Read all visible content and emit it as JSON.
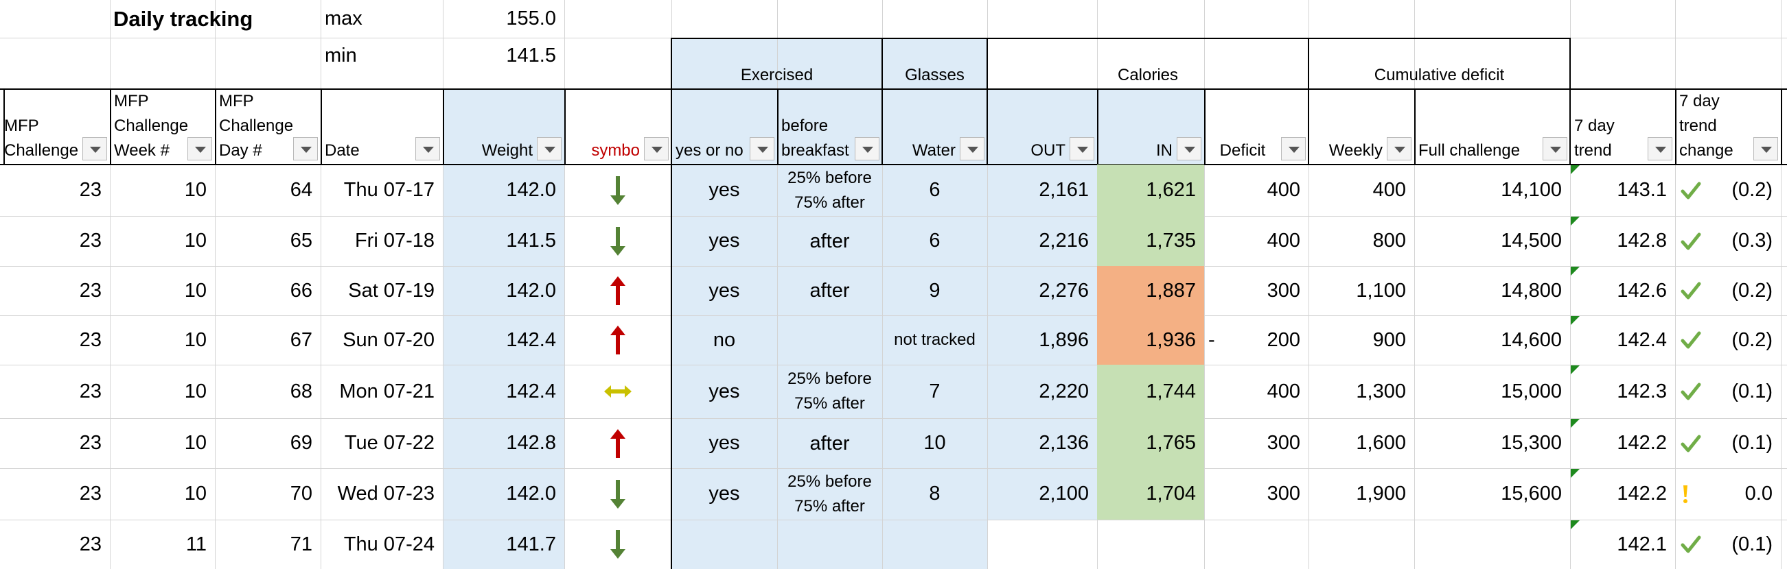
{
  "title": "Daily tracking",
  "summary": {
    "max_label": "max",
    "max_value": "155.0",
    "min_label": "min",
    "min_value": "141.5"
  },
  "group_headers": {
    "exercised": "Exercised",
    "glasses": "Glasses",
    "calories": "Calories",
    "cumulative_deficit": "Cumulative deficit"
  },
  "columns": {
    "challenge": [
      "MFP",
      "Challenge"
    ],
    "week": [
      "MFP",
      "Challenge",
      "Week #"
    ],
    "day": [
      "MFP",
      "Challenge",
      "Day #"
    ],
    "date": "Date",
    "weight": "Weight",
    "symbol": "symbo",
    "yes_no": "yes or no",
    "before_breakfast": [
      "before",
      "breakfast"
    ],
    "water": "Water",
    "out": "OUT",
    "in": "IN",
    "deficit": "Deficit",
    "weekly": "Weekly",
    "full": "Full challenge",
    "trend": "7 day trend",
    "trend_change": [
      "7 day trend",
      "change"
    ]
  },
  "colors": {
    "header_blue": "#ddebf7",
    "green_fill": "#c6e0b4",
    "orange_fill": "#f4b084",
    "arrow_down": "#548235",
    "arrow_up": "#c00000",
    "arrow_side": "#c9c000",
    "check": "#70ad47",
    "warn": "#ffc000"
  },
  "rows": [
    {
      "challenge": "23",
      "week": "10",
      "day": "64",
      "date": "Thu 07-17",
      "weight": "142.0",
      "symbol": "down-arrow-icon",
      "yes_no": "yes",
      "breakfast": [
        "25% before",
        "75% after"
      ],
      "water": "6",
      "out": "2,161",
      "in": "1,621",
      "in_fill": "green",
      "deficit_prefix": "",
      "deficit": "400",
      "weekly": "400",
      "full": "14,100",
      "trend": "143.1",
      "trend_icon": "check-icon",
      "trend_change": "(0.2)"
    },
    {
      "challenge": "23",
      "week": "10",
      "day": "65",
      "date": "Fri 07-18",
      "weight": "141.5",
      "symbol": "down-arrow-icon",
      "yes_no": "yes",
      "breakfast": [
        "after"
      ],
      "water": "6",
      "out": "2,216",
      "in": "1,735",
      "in_fill": "green",
      "deficit_prefix": "",
      "deficit": "400",
      "weekly": "800",
      "full": "14,500",
      "trend": "142.8",
      "trend_icon": "check-icon",
      "trend_change": "(0.3)"
    },
    {
      "challenge": "23",
      "week": "10",
      "day": "66",
      "date": "Sat 07-19",
      "weight": "142.0",
      "symbol": "up-arrow-icon",
      "yes_no": "yes",
      "breakfast": [
        "after"
      ],
      "water": "9",
      "out": "2,276",
      "in": "1,887",
      "in_fill": "orange",
      "deficit_prefix": "",
      "deficit": "300",
      "weekly": "1,100",
      "full": "14,800",
      "trend": "142.6",
      "trend_icon": "check-icon",
      "trend_change": "(0.2)"
    },
    {
      "challenge": "23",
      "week": "10",
      "day": "67",
      "date": "Sun 07-20",
      "weight": "142.4",
      "symbol": "up-arrow-icon",
      "yes_no": "no",
      "breakfast": [],
      "water": "not tracked",
      "out": "1,896",
      "in": "1,936",
      "in_fill": "orange",
      "deficit_prefix": "-",
      "deficit": "200",
      "weekly": "900",
      "full": "14,600",
      "trend": "142.4",
      "trend_icon": "check-icon",
      "trend_change": "(0.2)"
    },
    {
      "challenge": "23",
      "week": "10",
      "day": "68",
      "date": "Mon 07-21",
      "weight": "142.4",
      "symbol": "side-arrow-icon",
      "yes_no": "yes",
      "breakfast": [
        "25% before",
        "75% after"
      ],
      "water": "7",
      "out": "2,220",
      "in": "1,744",
      "in_fill": "green",
      "deficit_prefix": "",
      "deficit": "400",
      "weekly": "1,300",
      "full": "15,000",
      "trend": "142.3",
      "trend_icon": "check-icon",
      "trend_change": "(0.1)"
    },
    {
      "challenge": "23",
      "week": "10",
      "day": "69",
      "date": "Tue 07-22",
      "weight": "142.8",
      "symbol": "up-arrow-icon",
      "yes_no": "yes",
      "breakfast": [
        "after"
      ],
      "water": "10",
      "out": "2,136",
      "in": "1,765",
      "in_fill": "green",
      "deficit_prefix": "",
      "deficit": "300",
      "weekly": "1,600",
      "full": "15,300",
      "trend": "142.2",
      "trend_icon": "check-icon",
      "trend_change": "(0.1)"
    },
    {
      "challenge": "23",
      "week": "10",
      "day": "70",
      "date": "Wed 07-23",
      "weight": "142.0",
      "symbol": "down-arrow-icon",
      "yes_no": "yes",
      "breakfast": [
        "25% before",
        "75% after"
      ],
      "water": "8",
      "out": "2,100",
      "in": "1,704",
      "in_fill": "green",
      "deficit_prefix": "",
      "deficit": "300",
      "weekly": "1,900",
      "full": "15,600",
      "trend": "142.2",
      "trend_icon": "exclamation-icon",
      "trend_change": "0.0"
    },
    {
      "challenge": "23",
      "week": "11",
      "day": "71",
      "date": "Thu 07-24",
      "weight": "141.7",
      "symbol": "down-arrow-icon",
      "yes_no": "",
      "breakfast": [],
      "water": "",
      "out": "",
      "in": "",
      "in_fill": "none",
      "deficit_prefix": "",
      "deficit": "",
      "weekly": "",
      "full": "",
      "trend": "142.1",
      "trend_icon": "check-icon",
      "trend_change": "(0.1)"
    }
  ]
}
